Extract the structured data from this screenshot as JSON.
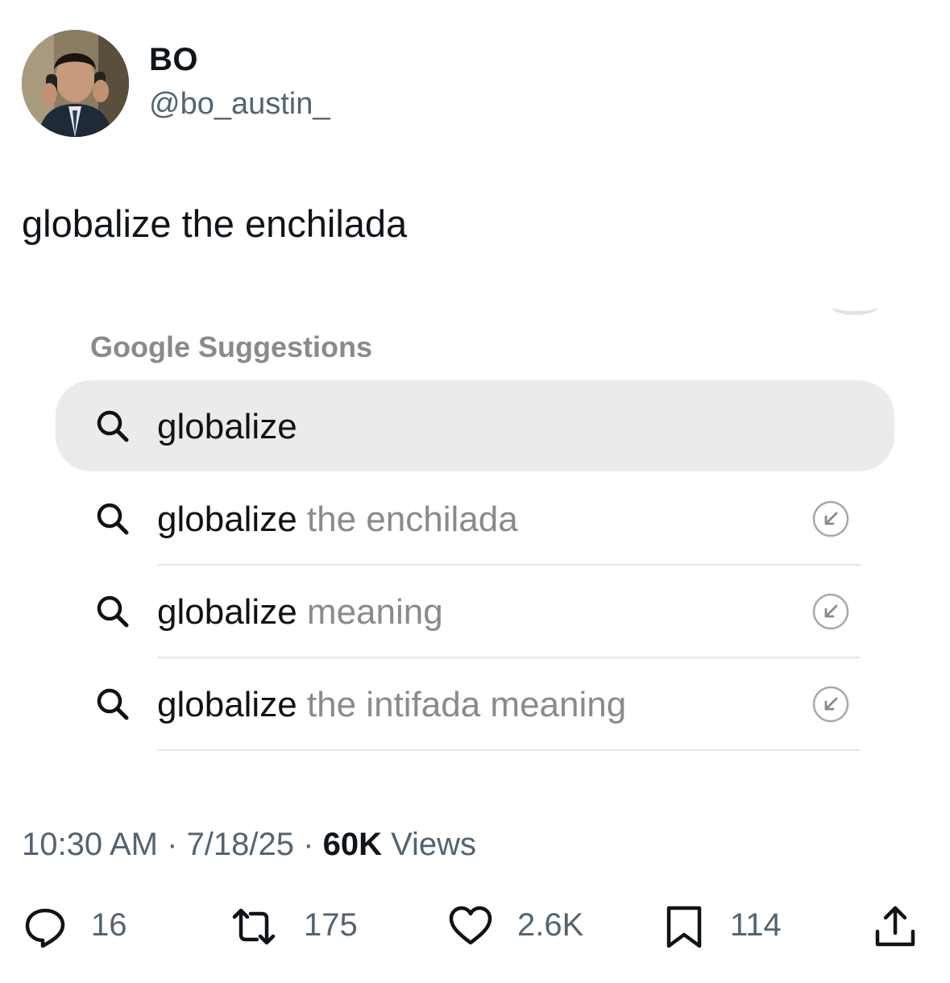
{
  "user": {
    "display_name": "BO",
    "handle": "@bo_austin_"
  },
  "tweet": {
    "text": "globalize the enchilada"
  },
  "suggestions_panel": {
    "title": "Google Suggestions",
    "query": "globalize",
    "items": [
      {
        "bold": "globalize",
        "rest": " the enchilada",
        "icon": "arrow-up-left-icon"
      },
      {
        "bold": "globalize",
        "rest": " meaning",
        "icon": "arrow-up-left-icon"
      },
      {
        "bold": "globalize",
        "rest": " the intifada meaning",
        "icon": "arrow-up-left-icon"
      }
    ]
  },
  "meta": {
    "time": "10:30 AM",
    "sep1": " · ",
    "date": "7/18/25",
    "sep2": " · ",
    "views_count": "60K",
    "views_label": " Views"
  },
  "actions": {
    "replies": "16",
    "reposts": "175",
    "likes": "2.6K",
    "bookmarks": "114"
  },
  "icons": [
    "avatar",
    "search-icon",
    "arrow-up-left-icon",
    "reply-icon",
    "repost-icon",
    "like-icon",
    "bookmark-icon",
    "share-icon"
  ],
  "colors": {
    "text_primary": "#0f1419",
    "text_secondary": "#536471",
    "suggestion_muted": "#8a8a8e",
    "query_pill": "#ebebeb"
  }
}
